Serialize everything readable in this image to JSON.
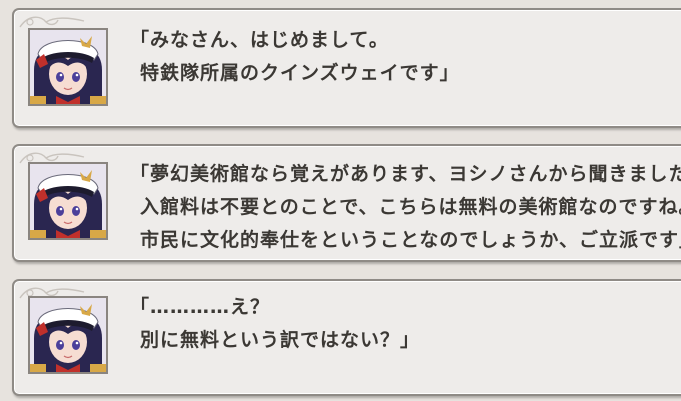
{
  "messages": [
    {
      "speaker_icon": "character-portrait",
      "lines": [
        "「みなさん、はじめまして。",
        "特鉄隊所属のクインズウェイです」"
      ]
    },
    {
      "speaker_icon": "character-portrait",
      "lines": [
        "「夢幻美術館なら覚えがあります、ヨシノさんから聞きました。",
        "入館料は不要とのことで、こちらは無料の美術館なのですね。",
        "市民に文化的奉仕をということなのでしょうか、ご立派です」"
      ]
    },
    {
      "speaker_icon": "character-portrait",
      "lines": [
        "「…………え？",
        "別に無料という訳ではない？」"
      ]
    }
  ],
  "colors": {
    "background": "#e7e3de",
    "panel": "#eeecea",
    "panel_border": "#8f8b86",
    "text": "#3b3834",
    "hair": "#2a2650",
    "cap": "#ffffff",
    "cap_band": "#1d1b2e",
    "ribbon": "#c0302b",
    "gold": "#d8a847"
  }
}
